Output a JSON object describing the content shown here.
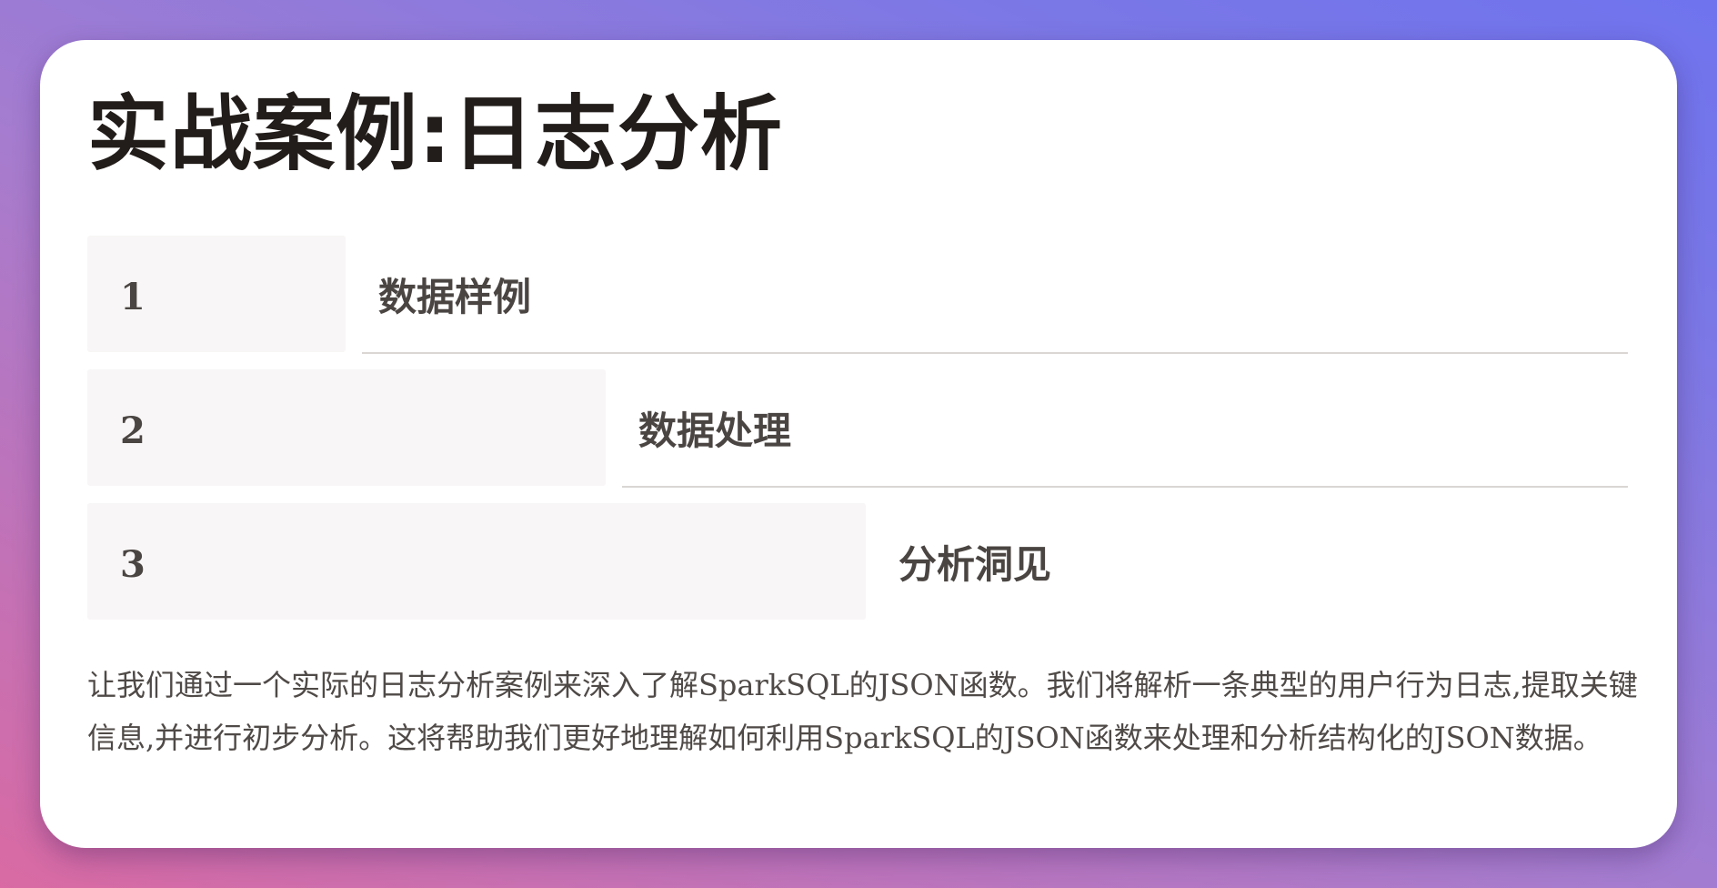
{
  "slide": {
    "title": "实战案例:日志分析",
    "steps": [
      {
        "number": "1",
        "label": "数据样例"
      },
      {
        "number": "2",
        "label": "数据处理"
      },
      {
        "number": "3",
        "label": "分析洞见"
      }
    ],
    "description": "让我们通过一个实际的日志分析案例来深入了解SparkSQL的JSON函数。我们将解析一条典型的用户行为日志,提取关键信息,并进行初步分析。这将帮助我们更好地理解如何利用SparkSQL的JSON函数来处理和分析结构化的JSON数据。"
  },
  "colors": {
    "background_start": "#d96aa3",
    "background_end": "#6f73ee",
    "card": "#ffffff",
    "step_box": "#f8f6f6",
    "title_text": "#221d1a",
    "body_text": "#4f4a47"
  }
}
